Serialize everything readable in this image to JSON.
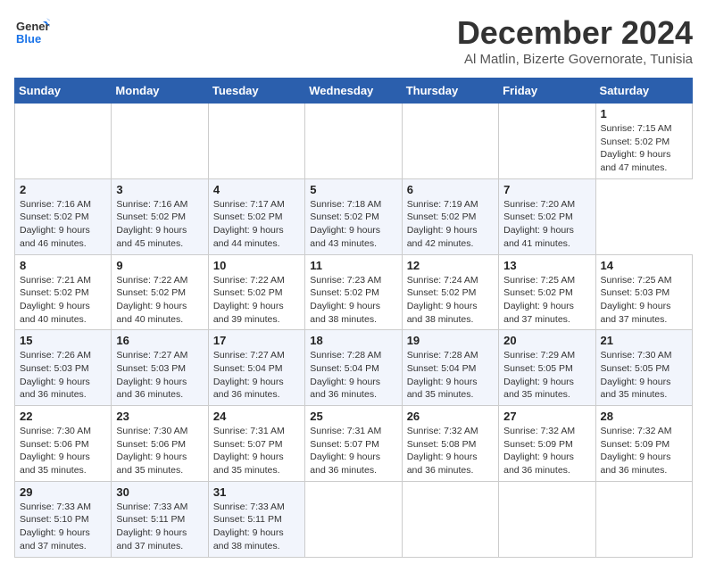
{
  "header": {
    "logo_line1": "General",
    "logo_line2": "Blue",
    "main_title": "December 2024",
    "subtitle": "Al Matlin, Bizerte Governorate, Tunisia"
  },
  "calendar": {
    "headers": [
      "Sunday",
      "Monday",
      "Tuesday",
      "Wednesday",
      "Thursday",
      "Friday",
      "Saturday"
    ],
    "weeks": [
      [
        null,
        null,
        null,
        null,
        null,
        null,
        {
          "day": "1",
          "sunrise": "7:15 AM",
          "sunset": "5:02 PM",
          "daylight": "9 hours and 47 minutes."
        }
      ],
      [
        {
          "day": "2",
          "sunrise": "7:16 AM",
          "sunset": "5:02 PM",
          "daylight": "9 hours and 46 minutes."
        },
        {
          "day": "3",
          "sunrise": "7:16 AM",
          "sunset": "5:02 PM",
          "daylight": "9 hours and 45 minutes."
        },
        {
          "day": "4",
          "sunrise": "7:17 AM",
          "sunset": "5:02 PM",
          "daylight": "9 hours and 44 minutes."
        },
        {
          "day": "5",
          "sunrise": "7:18 AM",
          "sunset": "5:02 PM",
          "daylight": "9 hours and 43 minutes."
        },
        {
          "day": "6",
          "sunrise": "7:19 AM",
          "sunset": "5:02 PM",
          "daylight": "9 hours and 42 minutes."
        },
        {
          "day": "7",
          "sunrise": "7:20 AM",
          "sunset": "5:02 PM",
          "daylight": "9 hours and 41 minutes."
        }
      ],
      [
        {
          "day": "8",
          "sunrise": "7:21 AM",
          "sunset": "5:02 PM",
          "daylight": "9 hours and 40 minutes."
        },
        {
          "day": "9",
          "sunrise": "7:22 AM",
          "sunset": "5:02 PM",
          "daylight": "9 hours and 40 minutes."
        },
        {
          "day": "10",
          "sunrise": "7:22 AM",
          "sunset": "5:02 PM",
          "daylight": "9 hours and 39 minutes."
        },
        {
          "day": "11",
          "sunrise": "7:23 AM",
          "sunset": "5:02 PM",
          "daylight": "9 hours and 38 minutes."
        },
        {
          "day": "12",
          "sunrise": "7:24 AM",
          "sunset": "5:02 PM",
          "daylight": "9 hours and 38 minutes."
        },
        {
          "day": "13",
          "sunrise": "7:25 AM",
          "sunset": "5:02 PM",
          "daylight": "9 hours and 37 minutes."
        },
        {
          "day": "14",
          "sunrise": "7:25 AM",
          "sunset": "5:03 PM",
          "daylight": "9 hours and 37 minutes."
        }
      ],
      [
        {
          "day": "15",
          "sunrise": "7:26 AM",
          "sunset": "5:03 PM",
          "daylight": "9 hours and 36 minutes."
        },
        {
          "day": "16",
          "sunrise": "7:27 AM",
          "sunset": "5:03 PM",
          "daylight": "9 hours and 36 minutes."
        },
        {
          "day": "17",
          "sunrise": "7:27 AM",
          "sunset": "5:04 PM",
          "daylight": "9 hours and 36 minutes."
        },
        {
          "day": "18",
          "sunrise": "7:28 AM",
          "sunset": "5:04 PM",
          "daylight": "9 hours and 36 minutes."
        },
        {
          "day": "19",
          "sunrise": "7:28 AM",
          "sunset": "5:04 PM",
          "daylight": "9 hours and 35 minutes."
        },
        {
          "day": "20",
          "sunrise": "7:29 AM",
          "sunset": "5:05 PM",
          "daylight": "9 hours and 35 minutes."
        },
        {
          "day": "21",
          "sunrise": "7:30 AM",
          "sunset": "5:05 PM",
          "daylight": "9 hours and 35 minutes."
        }
      ],
      [
        {
          "day": "22",
          "sunrise": "7:30 AM",
          "sunset": "5:06 PM",
          "daylight": "9 hours and 35 minutes."
        },
        {
          "day": "23",
          "sunrise": "7:30 AM",
          "sunset": "5:06 PM",
          "daylight": "9 hours and 35 minutes."
        },
        {
          "day": "24",
          "sunrise": "7:31 AM",
          "sunset": "5:07 PM",
          "daylight": "9 hours and 35 minutes."
        },
        {
          "day": "25",
          "sunrise": "7:31 AM",
          "sunset": "5:07 PM",
          "daylight": "9 hours and 36 minutes."
        },
        {
          "day": "26",
          "sunrise": "7:32 AM",
          "sunset": "5:08 PM",
          "daylight": "9 hours and 36 minutes."
        },
        {
          "day": "27",
          "sunrise": "7:32 AM",
          "sunset": "5:09 PM",
          "daylight": "9 hours and 36 minutes."
        },
        {
          "day": "28",
          "sunrise": "7:32 AM",
          "sunset": "5:09 PM",
          "daylight": "9 hours and 36 minutes."
        }
      ],
      [
        {
          "day": "29",
          "sunrise": "7:33 AM",
          "sunset": "5:10 PM",
          "daylight": "9 hours and 37 minutes."
        },
        {
          "day": "30",
          "sunrise": "7:33 AM",
          "sunset": "5:11 PM",
          "daylight": "9 hours and 37 minutes."
        },
        {
          "day": "31",
          "sunrise": "7:33 AM",
          "sunset": "5:11 PM",
          "daylight": "9 hours and 38 minutes."
        },
        null,
        null,
        null,
        null
      ]
    ]
  }
}
